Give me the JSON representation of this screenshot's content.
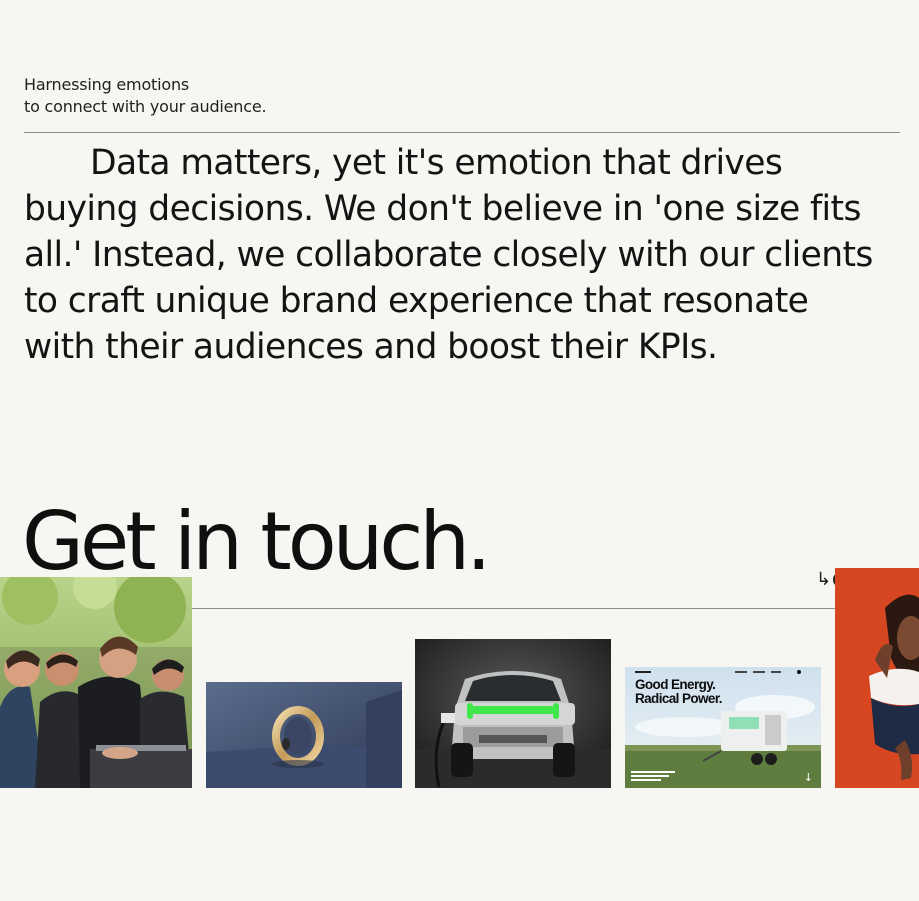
{
  "intro": {
    "eyebrow_line1": "Harnessing emotions",
    "eyebrow_line2": "to connect with your audience.",
    "paragraph": "Data matters, yet it's emotion that drives buying decisions. We don't believe in 'one size fits all.' Instead, we collaborate closely with our clients to craft unique brand experience that resonate with their audiences and boost their KPIs."
  },
  "contact": {
    "heading": "Get in touch.",
    "arrow_glyph": "↳",
    "peek_letter": "C"
  },
  "gallery": {
    "energy_headline_line1": "Good Energy.",
    "energy_headline_line2": "Radical Power.",
    "energy_arrow_glyph": "↓",
    "items": [
      {
        "name": "team-collaboration-photo"
      },
      {
        "name": "smart-ring-photo"
      },
      {
        "name": "electric-truck-photo"
      },
      {
        "name": "energy-website-preview"
      },
      {
        "name": "model-portrait-photo"
      }
    ]
  },
  "colors": {
    "background": "#f7f6f2",
    "text": "#121212",
    "divider": "#8c8c8c",
    "truck_light": "#3ee84a",
    "model_backdrop": "#dd4a22"
  }
}
